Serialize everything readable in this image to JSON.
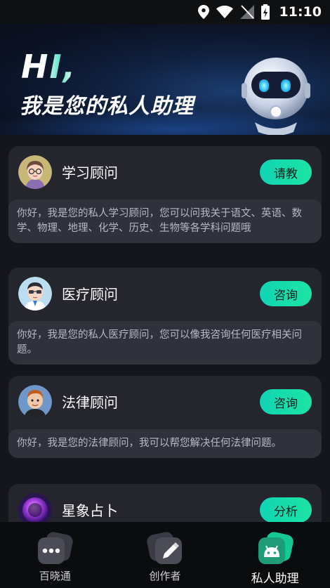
{
  "status_bar": {
    "time": "11:10"
  },
  "hero": {
    "greeting": "HI,",
    "title": "我是您的私人助理"
  },
  "cards": [
    {
      "title": "学习顾问",
      "button": "请教",
      "description": "你好，我是您的私人学习顾问，您可以问我关于语文、英语、数学、物理、地理、化学、历史、生物等各学科问题哦"
    },
    {
      "title": "医疗顾问",
      "button": "咨询",
      "description": "你好，我是您的私人医疗顾问，您可以像我咨询任何医疗相关问题。"
    },
    {
      "title": "法律顾问",
      "button": "咨询",
      "description": "你好，我是您的法律顾问，我可以帮您解决任何法律问题。"
    },
    {
      "title": "星象占卜",
      "button": "分析",
      "description": ""
    }
  ],
  "tabbar": {
    "tabs": [
      {
        "label": "百晓通",
        "icon": "chat-bubble-icon"
      },
      {
        "label": "创作者",
        "icon": "pencil-icon"
      },
      {
        "label": "私人助理",
        "icon": "android-robot-icon",
        "active": true
      }
    ]
  },
  "colors": {
    "accent": "#16dbb0",
    "card_bg": "#24252d",
    "page_bg": "#15161b"
  }
}
